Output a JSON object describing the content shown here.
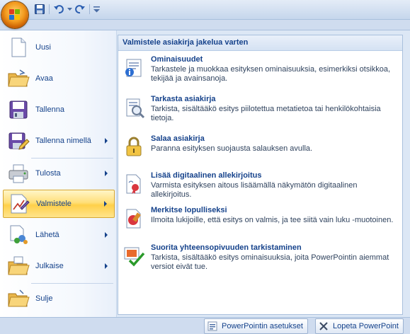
{
  "colors": {
    "accent": "#15428b",
    "highlight": "#ffd04a",
    "pane_border": "#a9c0dd"
  },
  "quick_access": {
    "items": [
      {
        "name": "save-icon"
      },
      {
        "name": "undo-icon"
      },
      {
        "name": "redo-icon"
      },
      {
        "name": "customize-icon"
      }
    ]
  },
  "left_menu": {
    "items": [
      {
        "label": "Uusi",
        "icon": "new-document-icon"
      },
      {
        "label": "Avaa",
        "icon": "open-folder-icon"
      },
      {
        "label": "Tallenna",
        "icon": "save-disk-icon"
      },
      {
        "label": "Tallenna nimellä",
        "icon": "save-as-icon",
        "submenu": true
      },
      {
        "label": "Tulosta",
        "icon": "printer-icon",
        "submenu": true
      },
      {
        "label": "Valmistele",
        "icon": "prepare-icon",
        "submenu": true,
        "active": true
      },
      {
        "label": "Lähetä",
        "icon": "send-icon",
        "submenu": true
      },
      {
        "label": "Julkaise",
        "icon": "publish-icon",
        "submenu": true
      },
      {
        "label": "Sulje",
        "icon": "close-document-icon"
      }
    ]
  },
  "right_pane": {
    "header": "Valmistele asiakirja jakelua varten",
    "items": [
      {
        "title": "Ominaisuudet",
        "desc": "Tarkastele ja muokkaa esityksen ominaisuuksia, esimerkiksi otsikkoa, tekijää ja avainsanoja.",
        "icon": "properties-icon"
      },
      {
        "title": "Tarkasta asiakirja",
        "desc": "Tarkista, sisältääkö esitys piilotettua metatietoa tai henkilökohtaisia tietoja.",
        "icon": "inspect-document-icon"
      },
      {
        "title": "Salaa asiakirja",
        "desc": "Paranna esityksen suojausta salauksen avulla.",
        "icon": "encrypt-lock-icon"
      },
      {
        "title": "Lisää digitaalinen allekirjoitus",
        "desc": "Varmista esityksen aitous lisäämällä näkymätön digitaalinen allekirjoitus.",
        "icon": "digital-signature-icon"
      },
      {
        "title": "Merkitse lopulliseksi",
        "desc": "Ilmoita lukijoille, että esitys on valmis, ja tee siitä vain luku -muotoinen.",
        "icon": "mark-final-icon"
      },
      {
        "title": "Suorita yhteensopivuuden tarkistaminen",
        "desc": "Tarkista, sisältääkö esitys ominaisuuksia, joita PowerPointin aiemmat versiot eivät tue.",
        "icon": "compatibility-check-icon"
      }
    ]
  },
  "bottom": {
    "options_label": "PowerPointin asetukset",
    "exit_label": "Lopeta PowerPoint"
  }
}
